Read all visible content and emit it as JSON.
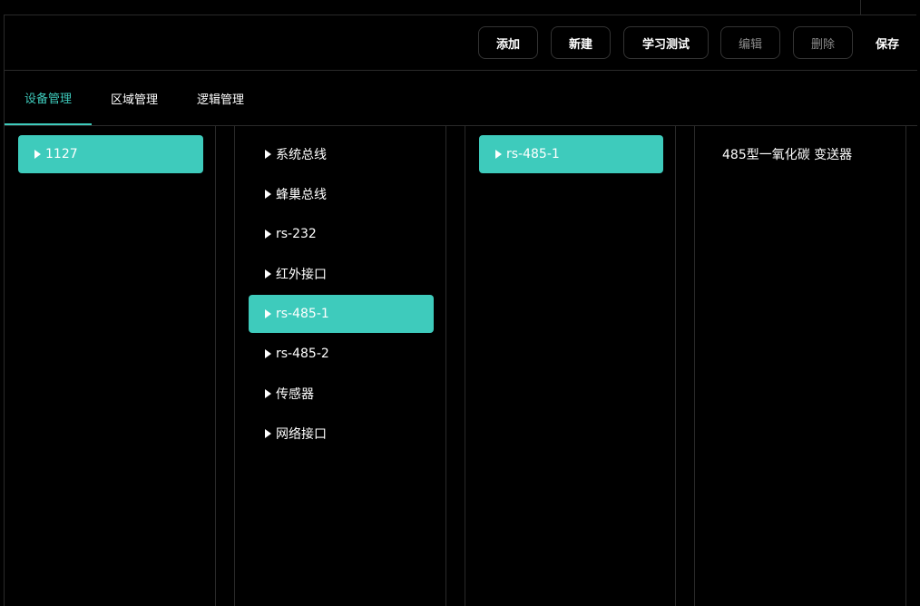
{
  "toolbar": {
    "add_label": "添加",
    "new_label": "新建",
    "learn_test_label": "学习测试",
    "edit_label": "编辑",
    "delete_label": "删除",
    "save_label": "保存"
  },
  "tabs": [
    {
      "label": "设备管理",
      "active": true
    },
    {
      "label": "区域管理",
      "active": false
    },
    {
      "label": "逻辑管理",
      "active": false
    }
  ],
  "column1": {
    "items": [
      {
        "label": "1127",
        "selected": true
      }
    ]
  },
  "column2": {
    "items": [
      {
        "label": "系统总线",
        "selected": false
      },
      {
        "label": "蜂巢总线",
        "selected": false
      },
      {
        "label": "rs-232",
        "selected": false
      },
      {
        "label": "红外接口",
        "selected": false
      },
      {
        "label": "rs-485-1",
        "selected": true
      },
      {
        "label": "rs-485-2",
        "selected": false
      },
      {
        "label": "传感器",
        "selected": false
      },
      {
        "label": "网络接口",
        "selected": false
      }
    ]
  },
  "column3": {
    "items": [
      {
        "label": "rs-485-1",
        "selected": true
      }
    ]
  },
  "column4": {
    "items": [
      {
        "label": "485型一氧化碳 变送器"
      }
    ]
  },
  "colors": {
    "accent": "#3ecbbc",
    "background": "#000000",
    "border": "#2a2a2a",
    "disabled_text": "#8a8a8a"
  }
}
